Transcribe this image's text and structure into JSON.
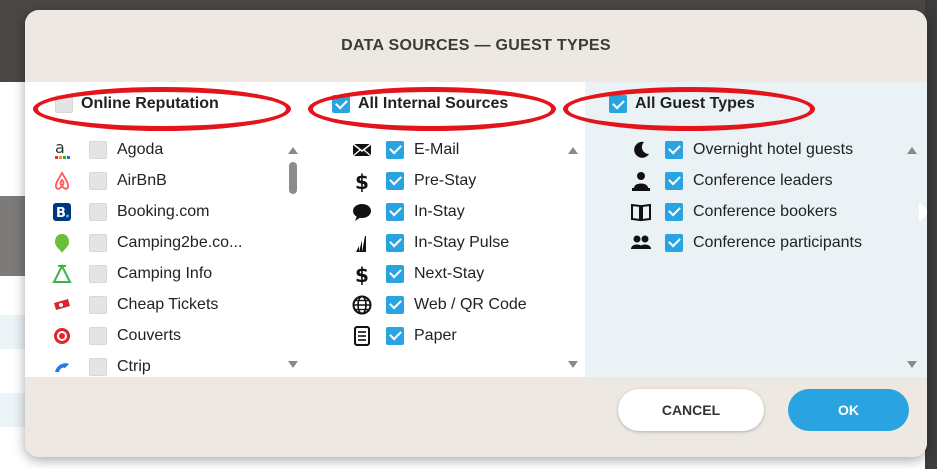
{
  "dialog": {
    "title": "DATA SOURCES — GUEST TYPES"
  },
  "columns": [
    {
      "header": {
        "label": "Online Reputation",
        "checked": false
      },
      "items": [
        {
          "label": "Agoda",
          "icon": "agoda-logo",
          "checked": false
        },
        {
          "label": "AirBnB",
          "icon": "airbnb-logo",
          "checked": false
        },
        {
          "label": "Booking.com",
          "icon": "booking-logo",
          "checked": false
        },
        {
          "label": "Camping2be.co...",
          "icon": "camping2be-logo",
          "checked": false
        },
        {
          "label": "Camping Info",
          "icon": "camping-info-logo",
          "checked": false
        },
        {
          "label": "Cheap Tickets",
          "icon": "cheap-tickets-logo",
          "checked": false
        },
        {
          "label": "Couverts",
          "icon": "couverts-logo",
          "checked": false
        },
        {
          "label": "Ctrip",
          "icon": "ctrip-logo",
          "checked": false
        }
      ]
    },
    {
      "header": {
        "label": "All Internal Sources",
        "checked": true
      },
      "items": [
        {
          "label": "E-Mail",
          "icon": "envelope-icon",
          "checked": true
        },
        {
          "label": "Pre-Stay",
          "icon": "dollar-icon",
          "checked": true
        },
        {
          "label": "In-Stay",
          "icon": "speech-bubble-icon",
          "checked": true
        },
        {
          "label": "In-Stay Pulse",
          "icon": "pulse-bars-icon",
          "checked": true
        },
        {
          "label": "Next-Stay",
          "icon": "dollar-icon",
          "checked": true
        },
        {
          "label": "Web / QR Code",
          "icon": "globe-icon",
          "checked": true
        },
        {
          "label": "Paper",
          "icon": "document-icon",
          "checked": true
        }
      ]
    },
    {
      "header": {
        "label": "All Guest Types",
        "checked": true
      },
      "items": [
        {
          "label": "Overnight hotel guests",
          "icon": "moon-icon",
          "checked": true
        },
        {
          "label": "Conference leaders",
          "icon": "presenter-icon",
          "checked": true
        },
        {
          "label": "Conference bookers",
          "icon": "book-icon",
          "checked": true
        },
        {
          "label": "Conference participants",
          "icon": "group-icon",
          "checked": true
        }
      ]
    }
  ],
  "footer": {
    "cancel_label": "CANCEL",
    "ok_label": "OK"
  },
  "colors": {
    "accent": "#2aa4e0",
    "highlight_oval": "#e3141b",
    "header_bg": "#ede8e1"
  }
}
